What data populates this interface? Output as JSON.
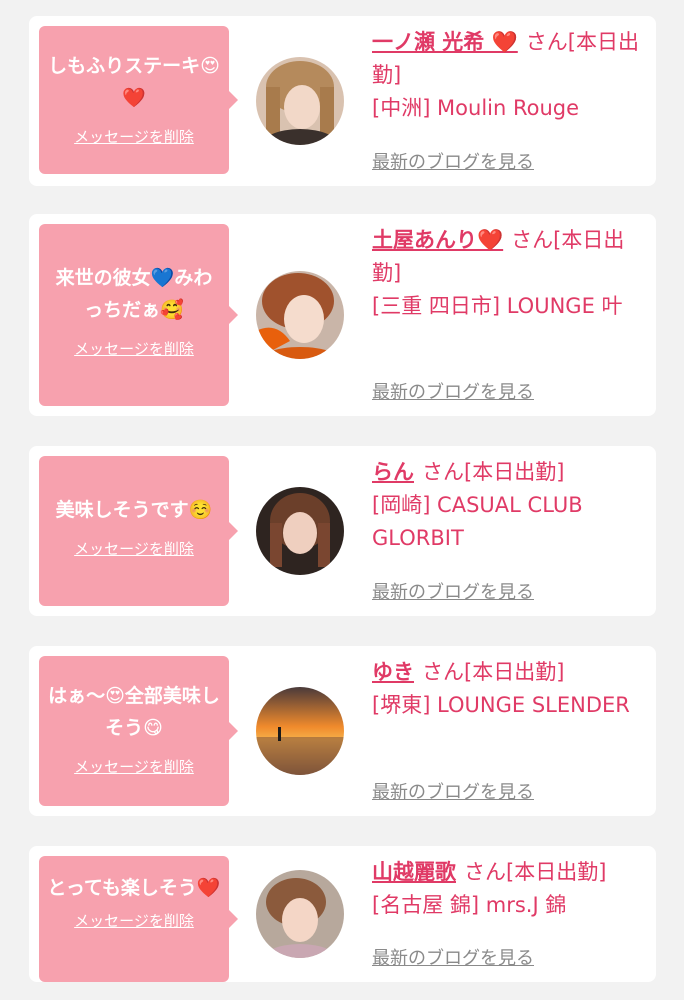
{
  "favorites": [
    {
      "message": "しもふりステーキ😍❤️",
      "delete_label": "メッセージを削除",
      "name": "一ノ瀬 光希 ❤️",
      "suffix": "さん[本日出勤]",
      "shop": "[中洲] Moulin Rouge",
      "blog_label": "最新のブログを見る",
      "avatar": "woman-portrait-1"
    },
    {
      "message": "来世の彼女💙みわっちだぁ🥰",
      "delete_label": "メッセージを削除",
      "name": "土屋あんり❤️",
      "suffix": "さん[本日出勤]",
      "shop": "[三重 四日市] LOUNGE 叶",
      "blog_label": "最新のブログを見る",
      "avatar": "woman-portrait-2"
    },
    {
      "message": "美味しそうです☺️",
      "delete_label": "メッセージを削除",
      "name": "らん",
      "suffix": "さん[本日出勤]",
      "shop": "[岡崎] CASUAL CLUB GLORBIT",
      "blog_label": "最新のブログを見る",
      "avatar": "woman-portrait-3"
    },
    {
      "message": "はぁ〜😍全部美味しそう😋",
      "delete_label": "メッセージを削除",
      "name": "ゆき",
      "suffix": "さん[本日出勤]",
      "shop": "[堺東] LOUNGE SLENDER",
      "blog_label": "最新のブログを見る",
      "avatar": "sunset-sea-photo"
    },
    {
      "message": "とっても楽しそう❤️",
      "delete_label": "メッセージを削除",
      "name": "山越麗歌",
      "suffix": "さん[本日出勤]",
      "shop": "[名古屋 錦] mrs.J 錦",
      "blog_label": "最新のブログを見る",
      "avatar": "woman-portrait-4"
    }
  ],
  "colors": {
    "page_bg": "#f2f2f2",
    "bubble": "#f7a1ae",
    "accent": "#e03a66",
    "muted": "#8a8a8a"
  }
}
